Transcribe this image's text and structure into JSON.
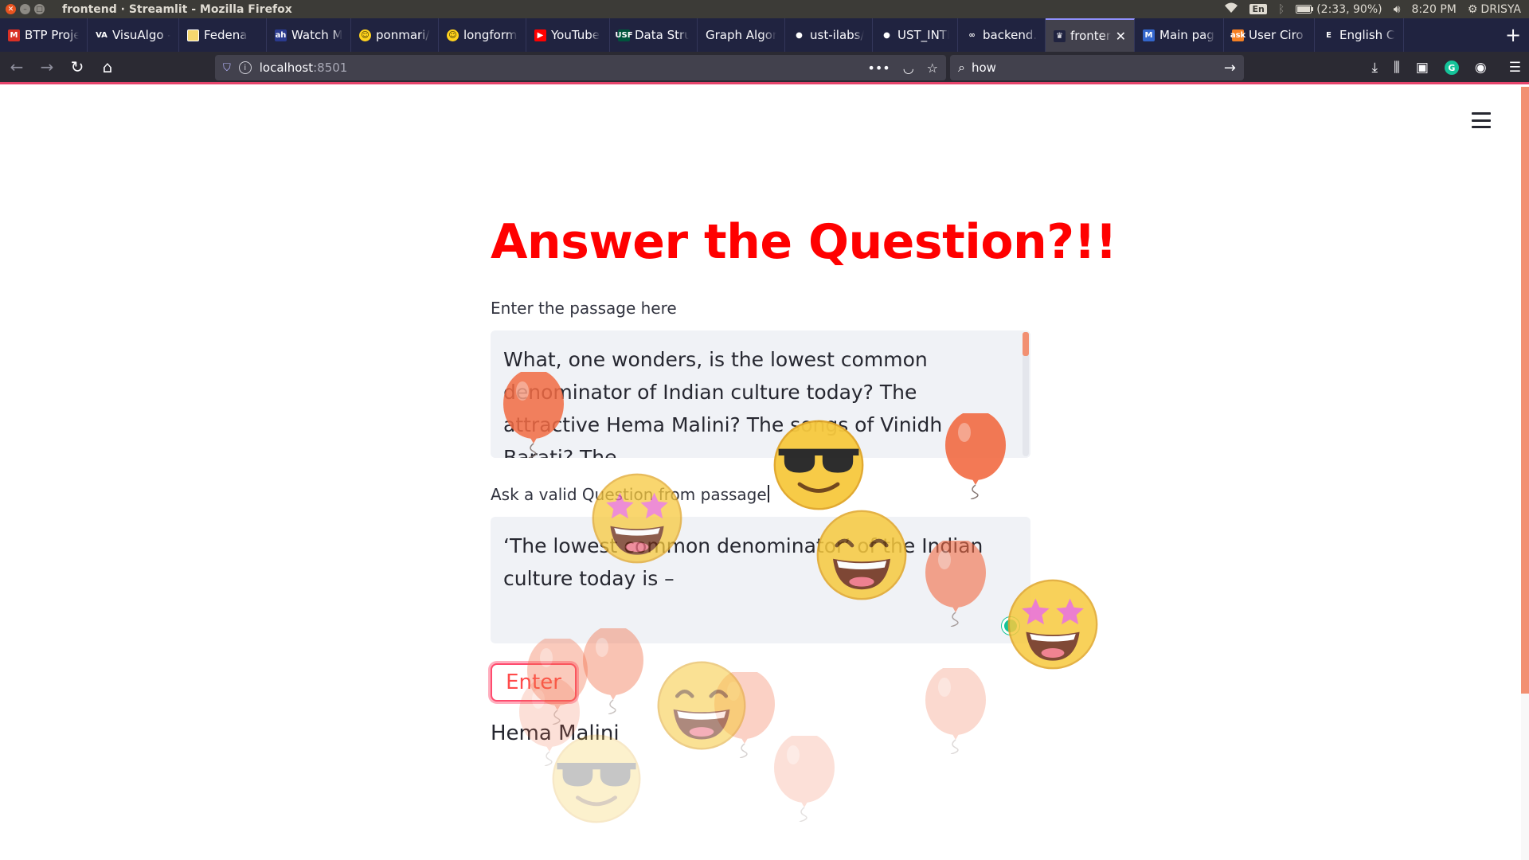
{
  "os_bar": {
    "window_title": "frontend · Streamlit - Mozilla Firefox",
    "keyboard_layout": "En",
    "battery": "(2:33, 90%)",
    "clock": "8:20 PM",
    "user": "DRISYA"
  },
  "tabs": [
    {
      "label": "BTP Project",
      "icon": "gmail-icon",
      "color": "#d93025",
      "glyph": "M"
    },
    {
      "label": "VisuAlgo -",
      "icon": "visualgo-icon",
      "color": "#202340",
      "glyph": "VA"
    },
    {
      "label": "Fedena",
      "icon": "page-icon",
      "color": "#f5d76e",
      "glyph": ""
    },
    {
      "label": "Watch Mov",
      "icon": "movie-icon",
      "color": "#2a3a8f",
      "glyph": "ah"
    },
    {
      "label": "ponmari/Q",
      "icon": "huggingface-icon",
      "color": "#ffd21e",
      "glyph": "☺"
    },
    {
      "label": "longformer",
      "icon": "huggingface-icon",
      "color": "#ffd21e",
      "glyph": "☺"
    },
    {
      "label": "YouTube",
      "icon": "youtube-icon",
      "color": "#ff0000",
      "glyph": "▶"
    },
    {
      "label": "Data Struct",
      "icon": "usf-icon",
      "color": "#00543c",
      "glyph": "USF"
    },
    {
      "label": "Graph Algorith",
      "icon": "none",
      "color": "",
      "glyph": ""
    },
    {
      "label": "ust-ilabs/ili",
      "icon": "github-icon",
      "color": "#202340",
      "glyph": "●"
    },
    {
      "label": "UST_INTER",
      "icon": "github-icon",
      "color": "#202340",
      "glyph": "●"
    },
    {
      "label": "backend.ipy",
      "icon": "colab-icon",
      "color": "#202340",
      "glyph": "∞"
    },
    {
      "label": "fronter",
      "icon": "streamlit-icon",
      "color": "#202340",
      "glyph": "♛",
      "active": true
    },
    {
      "label": "Main page",
      "icon": "mediawiki-icon",
      "color": "#3366cc",
      "glyph": "M"
    },
    {
      "label": "User Ciro S",
      "icon": "stackexchange-icon",
      "color": "#f48024",
      "glyph": "ask"
    },
    {
      "label": "English Cor",
      "icon": "wiki-icon",
      "color": "#202340",
      "glyph": "E"
    }
  ],
  "navbar": {
    "url_host": "localhost",
    "url_port": ":8501",
    "search_value": "how"
  },
  "app": {
    "title": "Answer the Question?!!",
    "passage_label": "Enter the passage here",
    "passage_value": " What, one wonders, is the lowest common denominator of Indian culture today? The attractive Hema Malini? The songs of Vinidh Barati? The",
    "question_label": "Ask a valid Question from passage",
    "question_value": "‘The lowest common denominator’ of the Indian culture today is –",
    "enter_label": "Enter",
    "answer": "Hema Malini"
  },
  "colors": {
    "title": "#ff0000",
    "accent": "#ff4b4b",
    "balloon": "#f26b43",
    "scrollbar": "#f29072"
  },
  "celebration": {
    "balloons": [
      {
        "name": "balloon-1",
        "opacity": 0.85
      },
      {
        "name": "balloon-2",
        "opacity": 0.9
      },
      {
        "name": "balloon-3",
        "opacity": 0.6
      },
      {
        "name": "balloon-4",
        "opacity": 0.35
      },
      {
        "name": "balloon-5",
        "opacity": 0.4
      },
      {
        "name": "balloon-6",
        "opacity": 0.3
      },
      {
        "name": "balloon-7",
        "opacity": 0.25
      },
      {
        "name": "balloon-8",
        "opacity": 0.2
      },
      {
        "name": "balloon-9",
        "opacity": 0.2
      }
    ],
    "emojis": [
      {
        "name": "sunglasses-emoji",
        "kind": "sunglasses",
        "opacity": 0.95
      },
      {
        "name": "star-struck-emoji",
        "kind": "starstruck",
        "opacity": 0.75
      },
      {
        "name": "grinning-emoji",
        "kind": "grin",
        "opacity": 0.85
      },
      {
        "name": "star-struck-emoji",
        "kind": "starstruck",
        "opacity": 0.85
      },
      {
        "name": "grinning-emoji",
        "kind": "grin",
        "opacity": 0.55
      },
      {
        "name": "sunglasses-emoji",
        "kind": "sunglasses",
        "opacity": 0.25
      }
    ]
  }
}
